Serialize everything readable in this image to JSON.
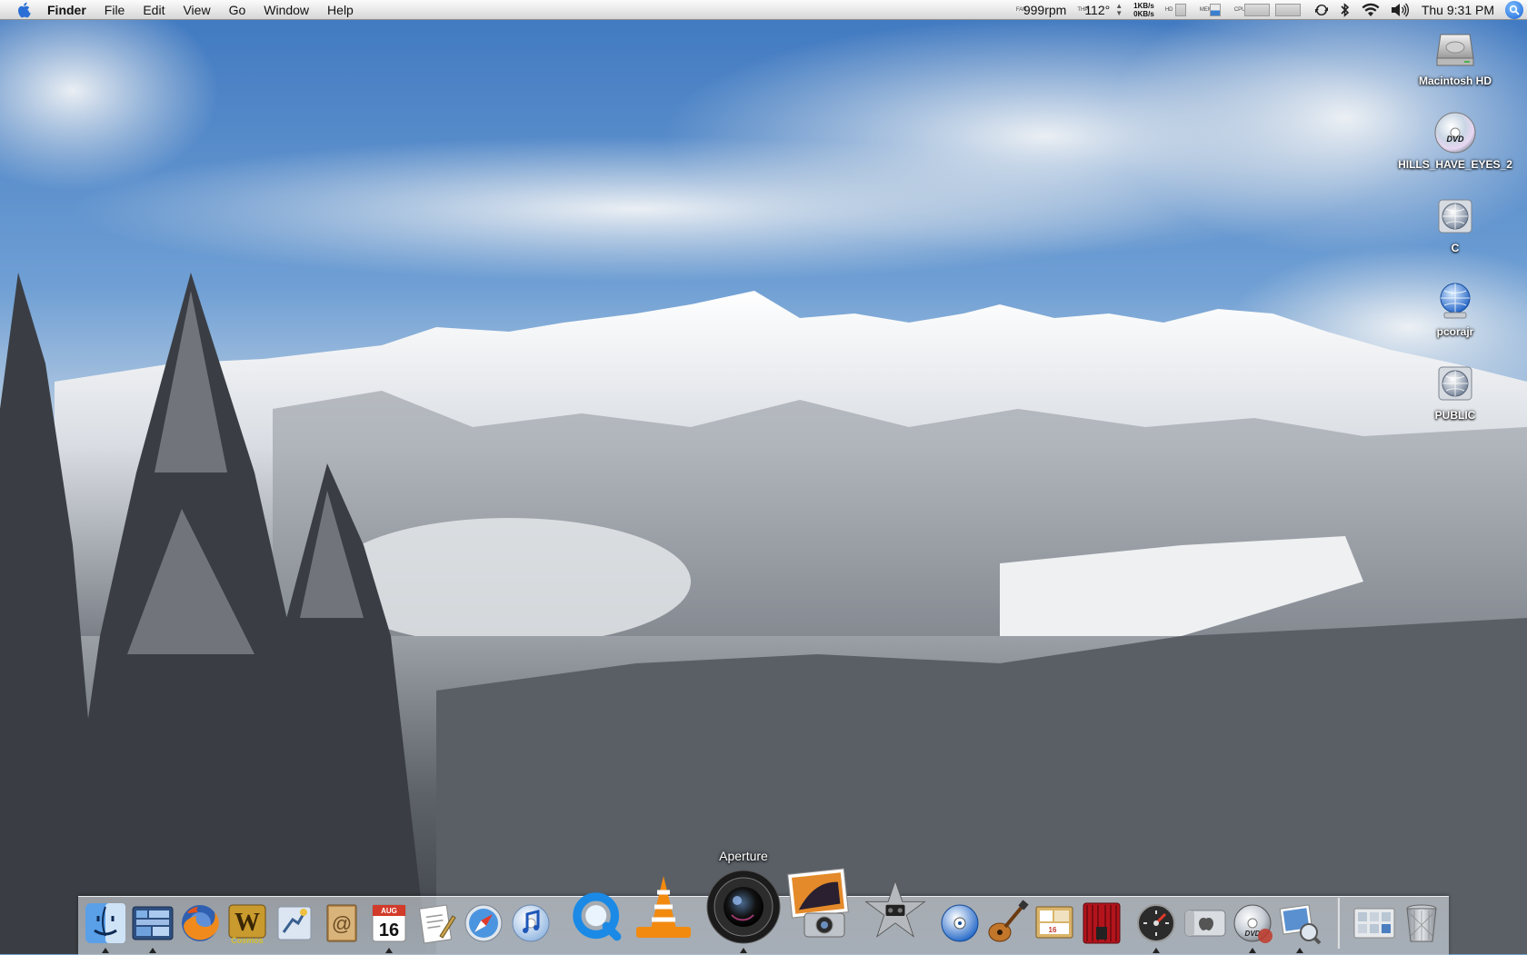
{
  "menubar": {
    "app_name": "Finder",
    "menus": [
      "File",
      "Edit",
      "View",
      "Go",
      "Window",
      "Help"
    ],
    "fan_label": "FAN",
    "fan_speed": "999rpm",
    "temp_label": "THP",
    "temperature": "112°",
    "net_up": "1KB/s",
    "net_down": "0KB/s",
    "disk_label": "HD",
    "mem_label": "MEM",
    "cpu_label": "CPU",
    "clock": "Thu 9:31 PM",
    "icons": [
      "apple-icon",
      "sync-icon",
      "bluetooth-icon",
      "wifi-icon",
      "volume-icon",
      "spotlight-icon"
    ]
  },
  "desktop": {
    "icons": [
      {
        "label": "Macintosh HD",
        "icon": "hard-drive-icon"
      },
      {
        "label": "HILLS_HAVE_EYES_2",
        "icon": "dvd-icon"
      },
      {
        "label": "C",
        "icon": "network-volume-icon"
      },
      {
        "label": "pcorajr",
        "icon": "network-volume-icon"
      },
      {
        "label": "PUBLIC",
        "icon": "network-volume-icon"
      }
    ]
  },
  "dock": {
    "tooltip": "Aperture",
    "calendar_month": "AUG",
    "calendar_day": "16",
    "apps": [
      "Finder",
      "Dashboard",
      "Firefox",
      "WoW Cosmos",
      "Mail Bird",
      "Address Book",
      "iCal",
      "TextEdit",
      "Safari",
      "iTunes",
      "QuickTime",
      "VLC",
      "Aperture",
      "iPhoto",
      "iMovie",
      "DVD Studio",
      "GarageBand",
      "iPhoto Library",
      "Front Row",
      "Time Machine",
      "Boot Camp",
      "DVD Player",
      "Preview",
      "Documents",
      "Trash"
    ]
  }
}
